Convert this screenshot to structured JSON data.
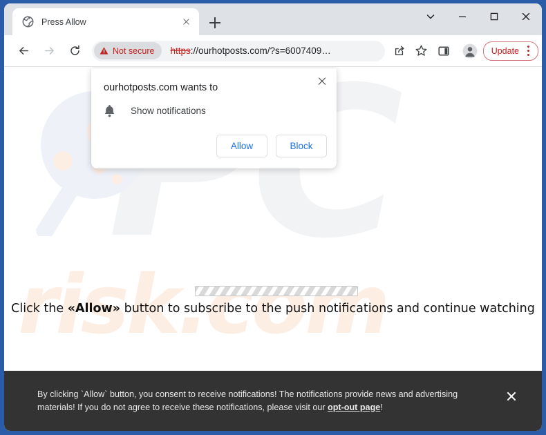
{
  "browser": {
    "tab": {
      "title": "Press Allow",
      "favicon": "globe-icon",
      "close_label": "Close tab"
    },
    "new_tab_label": "New tab",
    "window_controls": {
      "tab_search": "chevron-down-icon",
      "minimize": "minimize-icon",
      "maximize": "maximize-icon",
      "close": "close-icon"
    },
    "nav": {
      "back": "back-arrow-icon",
      "forward": "forward-arrow-icon",
      "reload": "reload-icon"
    },
    "omnibox": {
      "security_label": "Not secure",
      "security_icon": "warning-triangle-icon",
      "url_scheme": "https",
      "url_rest": "://ourhotposts.com/?s=6007409…"
    },
    "toolbar_icons": {
      "share": "share-icon",
      "bookmark": "star-icon",
      "side_panel": "side-panel-icon",
      "profile": "person-avatar-icon"
    },
    "update_button": {
      "label": "Update",
      "menu": "kebab-menu-icon"
    },
    "accent_red": "#c5221f",
    "frame_blue": "#2a5ca8"
  },
  "permission_bubble": {
    "title": "ourhotposts.com wants to",
    "permission_icon": "bell-icon",
    "permission_label": "Show notifications",
    "allow_label": "Allow",
    "block_label": "Block",
    "close_label": "Close",
    "link_color": "#1a73e8"
  },
  "page": {
    "headline_before": "Click the ",
    "headline_bold": "«Allow»",
    "headline_after": " button to subscribe to the push notifications and continue watching",
    "loading_bar": "striped-progress-bar",
    "watermark_pc": "PC",
    "watermark_risk": "risk.com"
  },
  "consent_banner": {
    "text_before": "By clicking `Allow` button, you consent to receive notifications! The notifications provide news and advertising materials! If you do not agree to receive these notifications, please visit our ",
    "link_label": "opt-out page",
    "text_after": "!",
    "close_label": "Close banner",
    "background": "#333333"
  }
}
